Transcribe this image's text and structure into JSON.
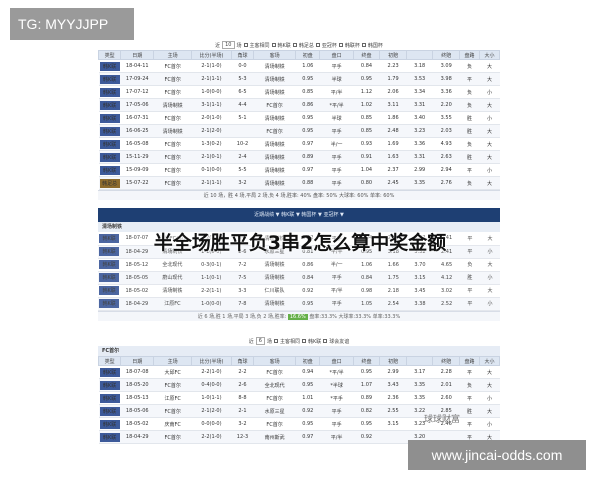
{
  "tag_badge": "TG: MYYJJPP",
  "url_badge": "www.jincai-odds.com",
  "headline": "半全场胜平负3串2怎么算中奖金额",
  "watermark": "球球财富",
  "section1": {
    "filter": {
      "prefix": "近",
      "count": "10",
      "suffix": "场",
      "opt1": "主客相同",
      "opt2": "韩K联",
      "opt3": "韩足总",
      "opt4": "亚冠杯",
      "opt5": "韩联杯",
      "opt6": "韩国杯"
    },
    "headers": [
      "类型",
      "日期",
      "主场",
      "比分(半场)",
      "角球",
      "客场",
      "初盘",
      "盘口",
      "终盘",
      "初赔",
      "",
      "终赔",
      "盘路",
      "大小"
    ],
    "rows": [
      [
        "韩K联",
        "18-04-11",
        "FC首尔",
        "2-1(1-0)",
        "0-0",
        "清场制铁",
        "1.06",
        "平手",
        "0.84",
        "2.23",
        "3.18",
        "3.09",
        "负",
        "大"
      ],
      [
        "韩K联",
        "17-09-24",
        "FC首尔",
        "2-1(1-1)",
        "5-3",
        "清场制铁",
        "0.95",
        "半球",
        "0.95",
        "1.79",
        "3.53",
        "3.98",
        "平",
        "大"
      ],
      [
        "韩K联",
        "17-07-12",
        "FC首尔",
        "1-0(0-0)",
        "6-5",
        "清场制铁",
        "0.85",
        "平/半",
        "1.12",
        "2.06",
        "3.34",
        "3.36",
        "负",
        "小"
      ],
      [
        "韩K联",
        "17-05-06",
        "清场制铁",
        "3-1(1-1)",
        "4-4",
        "FC首尔",
        "0.86",
        "*平/半",
        "1.02",
        "3.11",
        "3.31",
        "2.20",
        "负",
        "大"
      ],
      [
        "韩K联",
        "16-07-31",
        "FC首尔",
        "2-0(1-0)",
        "5-1",
        "清场制铁",
        "0.95",
        "半球",
        "0.85",
        "1.86",
        "3.40",
        "3.55",
        "胜",
        "小"
      ],
      [
        "韩K联",
        "16-06-25",
        "清场制铁",
        "2-1(2-0)",
        "",
        "FC首尔",
        "0.95",
        "平手",
        "0.85",
        "2.48",
        "3.23",
        "2.03",
        "胜",
        "大"
      ],
      [
        "韩K联",
        "16-05-08",
        "FC首尔",
        "1-3(0-2)",
        "10-2",
        "清场制铁",
        "0.97",
        "半/一",
        "0.93",
        "1.69",
        "3.36",
        "4.93",
        "负",
        "大"
      ],
      [
        "韩K联",
        "15-11-29",
        "FC首尔",
        "2-1(0-1)",
        "2-4",
        "清场制铁",
        "0.89",
        "平手",
        "0.91",
        "1.63",
        "3.31",
        "2.63",
        "胜",
        "大"
      ],
      [
        "韩K联",
        "15-09-09",
        "FC首尔",
        "0-1(0-0)",
        "5-5",
        "清场制铁",
        "0.97",
        "平手",
        "1.04",
        "2.37",
        "2.99",
        "2.94",
        "平",
        "小"
      ],
      [
        "韩足总",
        "15-07-22",
        "FC首尔",
        "2-1(1-1)",
        "3-2",
        "清场制铁",
        "0.88",
        "平手",
        "0.80",
        "2.45",
        "3.35",
        "2.76",
        "负",
        "大"
      ]
    ],
    "summary": "近 10 场，胜 4 场,平局 2 场,负 4 场,胜率: 40% 盘率: 50% 大球率: 60% 单率: 60%"
  },
  "band": {
    "text": "近期战绩 ▼  韩K联 ▼  韩国杯 ▼  亚冠杯 ▼"
  },
  "section2": {
    "title": "清场制铁",
    "rows": [
      [
        "韩K联",
        "18-07-07",
        "清场FC(中)",
        "2-2(1-1)",
        "6-3",
        "清场制铁",
        "0.92",
        "平手",
        "1.04",
        "2.62",
        "3.22",
        "2.41",
        "平",
        "大"
      ],
      [
        "韩K联",
        "18-04-29",
        "清场制铁",
        "1-1(0-0)",
        "2-6",
        "水原三星",
        "0.81",
        "平/半",
        "0.95",
        "3.18",
        "3.32",
        "2.41",
        "平",
        "小"
      ],
      [
        "韩K联",
        "18-05-12",
        "全北现代",
        "0-3(0-1)",
        "7-2",
        "清场制铁",
        "0.86",
        "半/一",
        "1.06",
        "1.66",
        "3.70",
        "4.65",
        "负",
        "大"
      ],
      [
        "韩K联",
        "18-05-05",
        "蔚山现代",
        "1-1(0-1)",
        "7-5",
        "清场制铁",
        "0.84",
        "平手",
        "0.84",
        "1.75",
        "3.15",
        "4.12",
        "胜",
        "小"
      ],
      [
        "韩K联",
        "18-05-02",
        "清场制铁",
        "2-2(1-1)",
        "3-3",
        "仁川联队",
        "0.92",
        "平/半",
        "0.98",
        "2.18",
        "3.45",
        "3.02",
        "平",
        "大"
      ],
      [
        "韩K联",
        "18-04-29",
        "江原FC",
        "1-0(0-0)",
        "7-8",
        "清场制铁",
        "0.95",
        "平手",
        "1.05",
        "2.54",
        "3.38",
        "2.52",
        "平",
        "小"
      ]
    ],
    "summary_prefix": "近 6 场,胜 1 场,平局 3 场,负 2 场,胜率:",
    "summary_pct": "16.6%",
    "summary_suffix": "盘率:33.3% 大球率:33.3% 单率:33.3%"
  },
  "section3": {
    "filter": {
      "prefix": "近",
      "count": "6",
      "suffix": "场",
      "opt1": "主客相同",
      "opt2": "韩K联",
      "opt3": "球会友谊"
    },
    "title": "FC首尔",
    "headers": [
      "类型",
      "日期",
      "主场",
      "比分(半场)",
      "角球",
      "客场",
      "初盘",
      "盘口",
      "终盘",
      "初赔",
      "",
      "终赔",
      "盘路",
      "大小"
    ],
    "rows": [
      [
        "韩K联",
        "18-07-08",
        "大邱FC",
        "2-2(1-0)",
        "2-2",
        "FC首尔",
        "0.94",
        "*平/半",
        "0.95",
        "2.99",
        "3.17",
        "2.28",
        "平",
        "大"
      ],
      [
        "韩K联",
        "18-05-20",
        "FC首尔",
        "0-4(0-0)",
        "2-6",
        "全北现代",
        "0.95",
        "*半球",
        "1.07",
        "3.43",
        "3.35",
        "2.01",
        "负",
        "大"
      ],
      [
        "韩K联",
        "18-05-13",
        "江原FC",
        "1-0(1-1)",
        "8-8",
        "FC首尔",
        "1.01",
        "*平手",
        "0.89",
        "2.36",
        "3.35",
        "2.60",
        "平",
        "小"
      ],
      [
        "韩K联",
        "18-05-06",
        "FC首尔",
        "2-1(2-0)",
        "2-1",
        "水原三星",
        "0.92",
        "平手",
        "0.82",
        "2.55",
        "3.22",
        "2.85",
        "胜",
        "大"
      ],
      [
        "韩K联",
        "18-05-02",
        "庆南FC",
        "0-0(0-0)",
        "3-2",
        "FC首尔",
        "0.95",
        "平手",
        "0.95",
        "3.15",
        "3.23",
        "2.46",
        "平",
        "小"
      ],
      [
        "韩K联",
        "18-04-29",
        "FC首尔",
        "2-2(1-0)",
        "12-3",
        "南州斯武",
        "0.97",
        "平/半",
        "0.92",
        "",
        "3.20",
        "",
        "平",
        "大"
      ]
    ]
  },
  "colors": {
    "league_badge": "#3d5a9a",
    "header_bg": "#dde6f2",
    "band_bg": "#1e3f73",
    "pct_bg": "#5aaa3a"
  }
}
